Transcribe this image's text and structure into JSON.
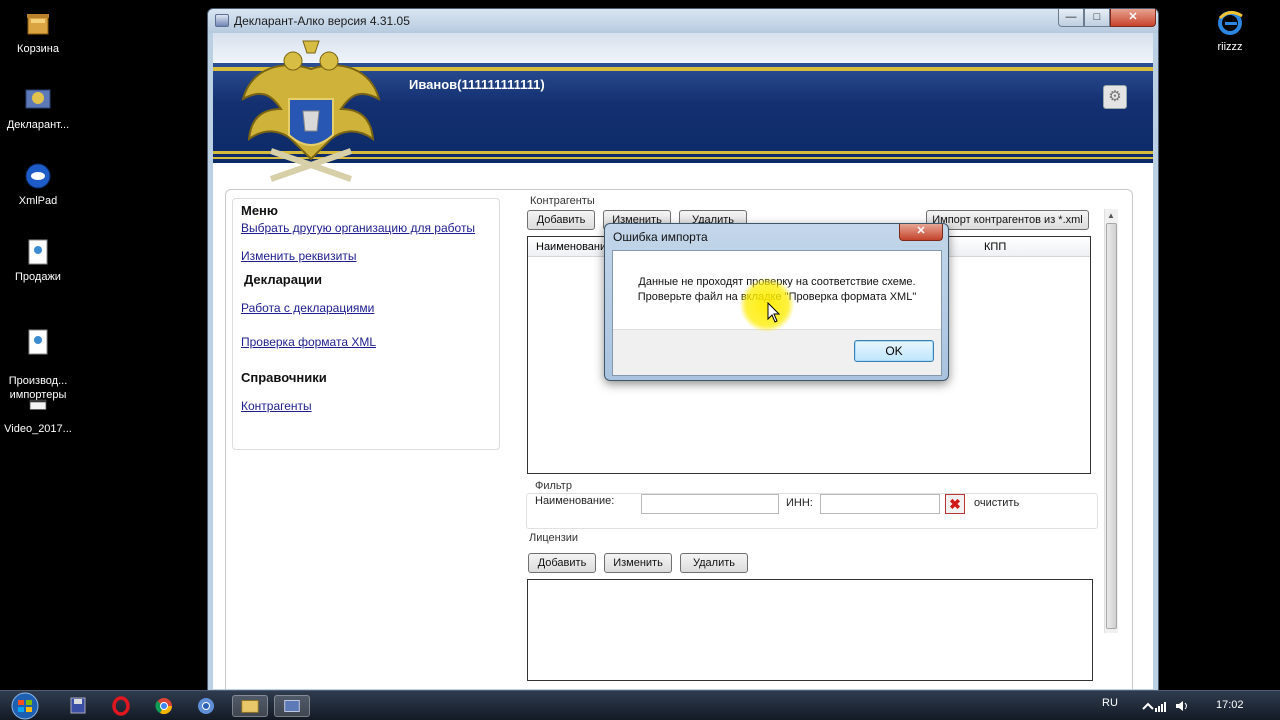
{
  "desktop": {
    "icons": [
      {
        "label": "Корзина"
      },
      {
        "label": "Декларант..."
      },
      {
        "label": "XmlPad"
      },
      {
        "label": "Продажи"
      },
      {
        "label": "Производ...\nимпортеры"
      },
      {
        "label": "Video_2017..."
      },
      {
        "label": "riizzz"
      }
    ]
  },
  "window": {
    "title": "Декларант-Алко версия 4.31.05",
    "controls": {
      "minimize": "—",
      "maximize": "□",
      "close": "✕"
    }
  },
  "banner": {
    "user": "Иванов(111111111111)",
    "gear_icon": "⚙"
  },
  "menu": {
    "heading_menu": "Меню",
    "link_change_org": "Выбрать другую организацию для работы",
    "link_edit_details": "Изменить реквизиты",
    "heading_declarations": "Декларации",
    "link_declarations": "Работа с декларациями",
    "link_xml_check": "Проверка формата XML",
    "heading_references": "Справочники",
    "link_counterparties": "Контрагенты"
  },
  "counterparties": {
    "group_label": "Контрагенты",
    "add": "Добавить",
    "edit": "Изменить",
    "delete": "Удалить",
    "import": "Импорт контрагентов из *.xml",
    "columns": [
      "Наименование",
      "КПП"
    ]
  },
  "filter": {
    "group_label": "Фильтр",
    "name_label": "Наименование:",
    "inn_label": "ИНН:",
    "clear_icon": "✖",
    "clear_label": "очистить"
  },
  "licenses": {
    "group_label": "Лицензии",
    "add": "Добавить",
    "edit": "Изменить",
    "delete": "Удалить"
  },
  "dialog": {
    "title": "Ошибка импорта",
    "close": "✕",
    "line1": "Данные не проходят проверку на соответствие схеме.",
    "line2": "Проверьте файл на вкладке \"Проверка формата XML\"",
    "ok": "OK"
  },
  "taskbar": {
    "lang": "RU",
    "time": "17:02"
  }
}
